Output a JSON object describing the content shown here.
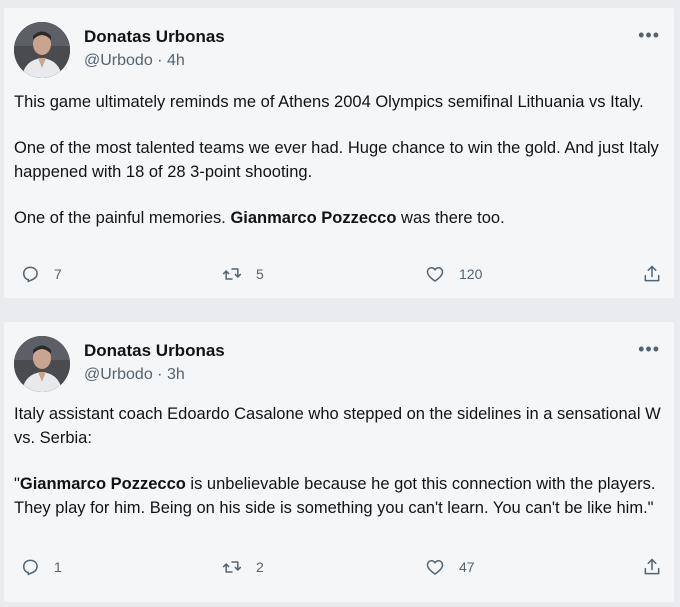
{
  "tweets": [
    {
      "author": {
        "name": "Donatas Urbonas",
        "handle": "@Urbodo",
        "separator": " · ",
        "time": "4h"
      },
      "more_label": "•••",
      "paragraphs": [
        [
          {
            "text": "This game ultimately reminds me of Athens 2004 Olympics semifinal Lithuania vs Italy.",
            "bold": false
          }
        ],
        [
          {
            "text": "One of the most talented teams we ever had. Huge chance to win the gold. And just Italy happened with 18 of 28 3-point shooting.",
            "bold": false
          }
        ],
        [
          {
            "text": "One of the painful memories. ",
            "bold": false
          },
          {
            "text": "Gianmarco Pozzecco",
            "bold": true
          },
          {
            "text": " was there too.",
            "bold": false
          }
        ]
      ],
      "stats": {
        "replies": "7",
        "retweets": "5",
        "likes": "120"
      }
    },
    {
      "author": {
        "name": "Donatas Urbonas",
        "handle": "@Urbodo",
        "separator": " · ",
        "time": "3h"
      },
      "more_label": "•••",
      "paragraphs": [
        [
          {
            "text": "Italy assistant coach Edoardo Casalone who stepped on the sidelines in a sensational W vs. Serbia:",
            "bold": false
          }
        ],
        [
          {
            "text": "\"",
            "bold": false
          },
          {
            "text": "Gianmarco Pozzecco",
            "bold": true
          },
          {
            "text": " is unbelievable because he got this connection with the players. They play for him. Being on his side is something you can't learn. You can't be like him.\"",
            "bold": false
          }
        ]
      ],
      "stats": {
        "replies": "1",
        "retweets": "2",
        "likes": "47"
      }
    }
  ],
  "icons": {
    "reply": "reply-icon",
    "retweet": "retweet-icon",
    "like": "heart-icon",
    "share": "share-icon",
    "more": "more-icon"
  }
}
